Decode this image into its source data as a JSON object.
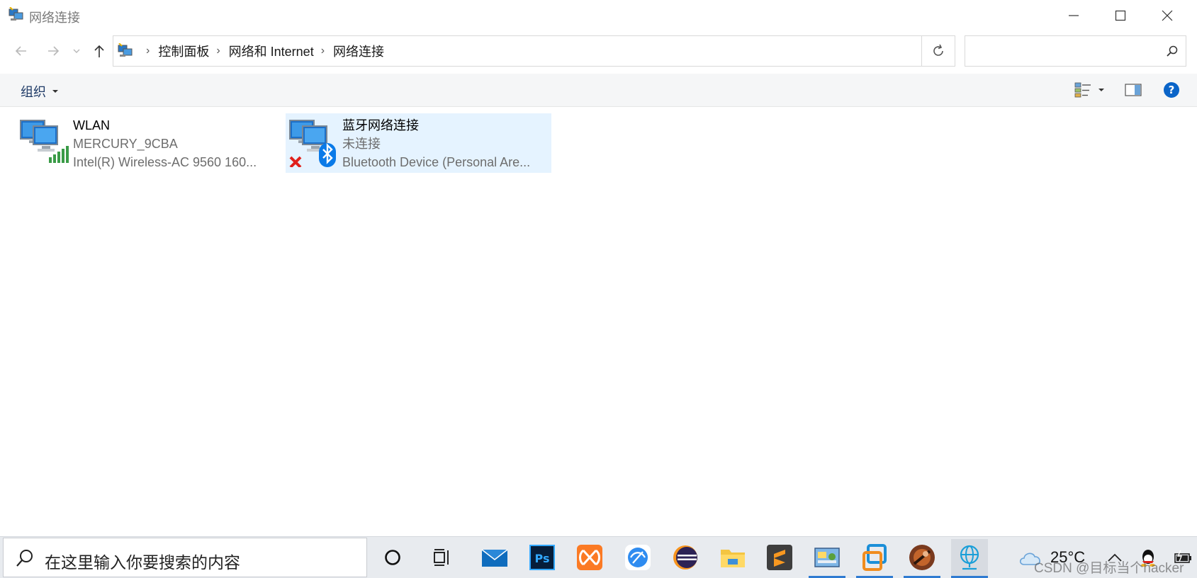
{
  "window": {
    "title": "网络连接",
    "controls": {
      "minimize": "minimize",
      "maximize": "maximize",
      "close": "close"
    }
  },
  "navigation": {
    "breadcrumbs": [
      "控制面板",
      "网络和 Internet",
      "网络连接"
    ],
    "search_placeholder": ""
  },
  "commandbar": {
    "organize_label": "组织"
  },
  "connections": [
    {
      "name": "WLAN",
      "status": "MERCURY_9CBA",
      "device": "Intel(R) Wireless-AC 9560 160...",
      "icon": "wifi-adapter-icon",
      "selected": false
    },
    {
      "name": "蓝牙网络连接",
      "status": "未连接",
      "device": "Bluetooth Device (Personal Are...",
      "icon": "bluetooth-adapter-icon",
      "selected": true
    }
  ],
  "taskbar": {
    "search_placeholder": "在这里输入你要搜索的内容",
    "apps": [
      "cortana",
      "task-view",
      "mail",
      "photoshop",
      "xampp",
      "browser",
      "eclipse",
      "file-explorer",
      "sublime-text",
      "control-panel",
      "virtualbox",
      "media-app",
      "network-connections"
    ],
    "weather_temp": "25°C"
  },
  "watermark": "CSDN @目标当个hacker",
  "colors": {
    "selection": "#e5f3ff",
    "accent": "#0078d7",
    "taskbar": "#e8ebef"
  }
}
